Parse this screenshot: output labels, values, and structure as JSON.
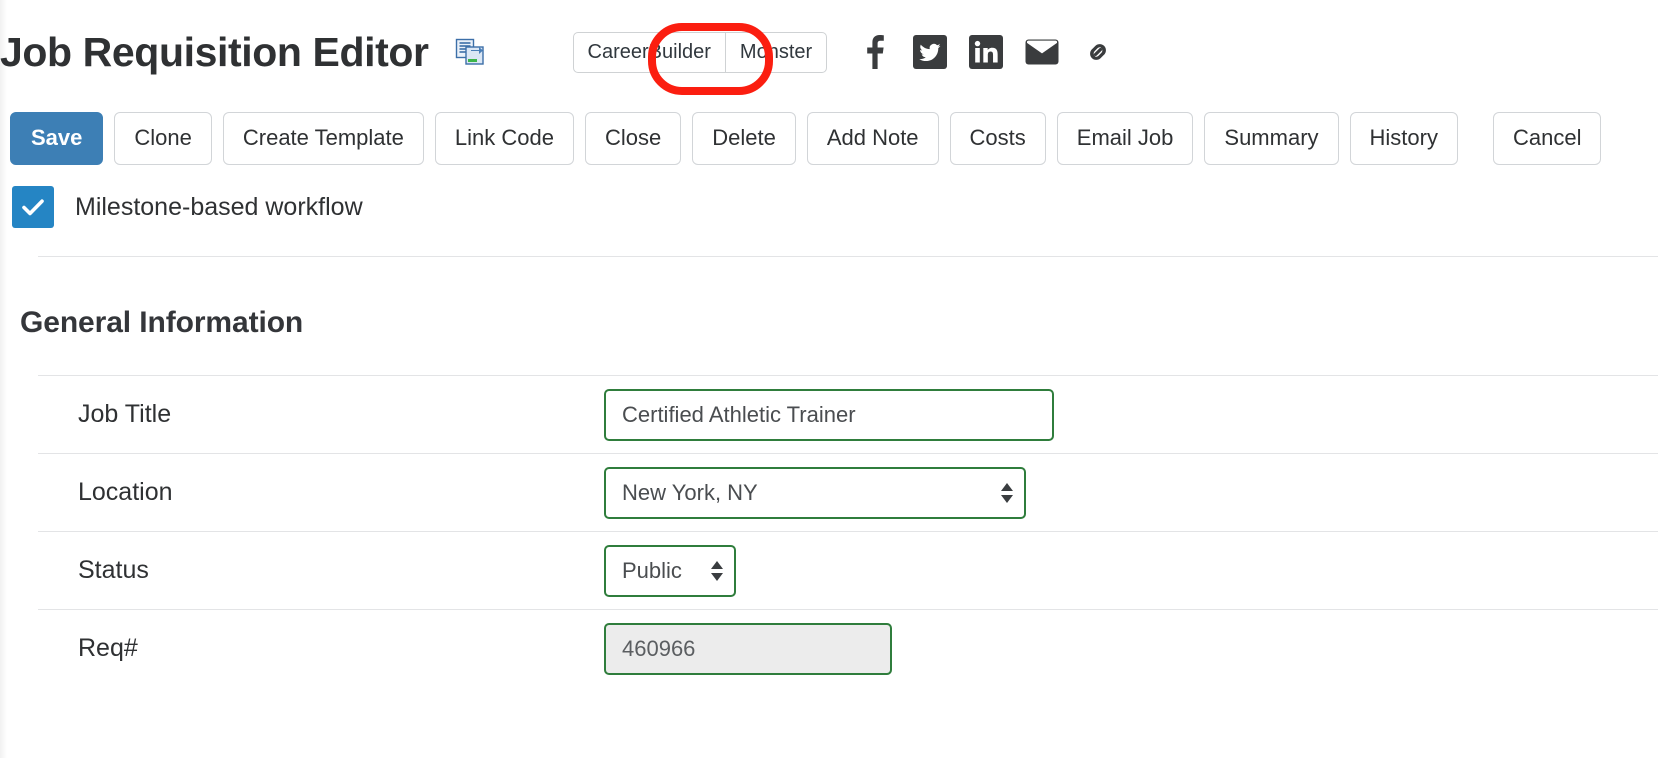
{
  "header": {
    "title": "Job Requisition Editor",
    "copy_icon": "copy-documents-icon",
    "tabs": [
      {
        "label": "CareerBuilder",
        "selected": false
      },
      {
        "label": "Monster",
        "selected": true,
        "highlighted": true
      }
    ],
    "social_icons": [
      {
        "name": "facebook-icon",
        "glyph": "f"
      },
      {
        "name": "twitter-icon",
        "glyph": "bird"
      },
      {
        "name": "linkedin-icon",
        "glyph": "in"
      },
      {
        "name": "email-icon",
        "glyph": "envelope"
      },
      {
        "name": "link-icon",
        "glyph": "chain"
      }
    ],
    "highlight_color": "#fb1e10"
  },
  "toolbar": {
    "buttons": [
      {
        "label": "Save",
        "primary": true
      },
      {
        "label": "Clone",
        "primary": false
      },
      {
        "label": "Create Template",
        "primary": false
      },
      {
        "label": "Link Code",
        "primary": false
      },
      {
        "label": "Close",
        "primary": false
      },
      {
        "label": "Delete",
        "primary": false
      },
      {
        "label": "Add Note",
        "primary": false
      },
      {
        "label": "Costs",
        "primary": false
      },
      {
        "label": "Email Job",
        "primary": false
      },
      {
        "label": "Summary",
        "primary": false
      },
      {
        "label": "History",
        "primary": false
      }
    ],
    "cancel_label": "Cancel",
    "primary_color": "#3d7fb5"
  },
  "workflow": {
    "checkbox_label": "Milestone-based workflow",
    "checked": true,
    "checkbox_color": "#2585c4"
  },
  "section": {
    "title": "General Information"
  },
  "fields": {
    "job_title": {
      "label": "Job Title",
      "value": "Certified Athletic Trainer",
      "placeholder": "",
      "type": "text"
    },
    "location": {
      "label": "Location",
      "value": "New York, NY",
      "type": "select",
      "options": [
        "New York, NY"
      ]
    },
    "status": {
      "label": "Status",
      "value": "Public",
      "type": "select",
      "options": [
        "Public"
      ]
    },
    "req_number": {
      "label": "Req#",
      "value": "460966",
      "type": "text",
      "disabled": true
    }
  },
  "colors": {
    "field_border_green": "#2f7d3c",
    "disabled_field_bg": "#ececec",
    "divider": "#e3e4e6",
    "text": "#2f3133"
  }
}
